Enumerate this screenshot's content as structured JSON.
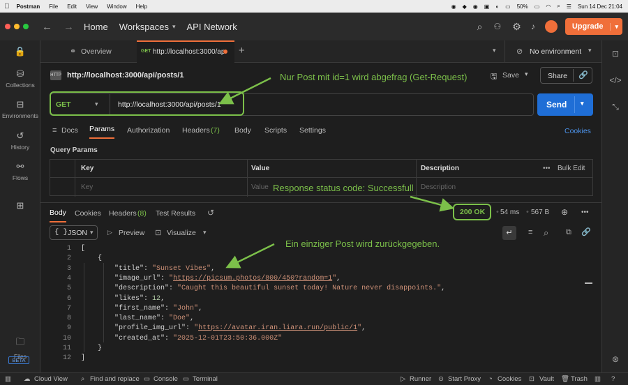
{
  "menubar": {
    "app": "Postman",
    "items": [
      "File",
      "Edit",
      "View",
      "Window",
      "Help"
    ],
    "battery": "50%",
    "datetime": "Sun 14 Dec 21:04"
  },
  "header": {
    "home": "Home",
    "workspaces": "Workspaces",
    "api_network": "API Network",
    "upgrade": "Upgrade"
  },
  "rail": {
    "items": [
      "Collections",
      "Environments",
      "History",
      "Flows"
    ],
    "files": "Files",
    "beta": "BETA"
  },
  "tabs": {
    "overview": "Overview",
    "active_method": "GET",
    "active_url": "http://localhost:3000/ap",
    "environment": "No environment"
  },
  "request": {
    "title": "http://localhost:3000/api/posts/1",
    "save": "Save",
    "share": "Share",
    "method": "GET",
    "url": "http://localhost:3000/api/posts/1",
    "send": "Send"
  },
  "req_tabs": {
    "docs": "Docs",
    "params": "Params",
    "authorization": "Authorization",
    "headers": "Headers",
    "headers_count": "(7)",
    "body": "Body",
    "scripts": "Scripts",
    "settings": "Settings",
    "cookies": "Cookies"
  },
  "query_params": {
    "title": "Query Params",
    "col_key": "Key",
    "col_value": "Value",
    "col_description": "Description",
    "bulk_edit": "Bulk Edit",
    "ph_key": "Key",
    "ph_value": "Value",
    "ph_description": "Description"
  },
  "response": {
    "tab_body": "Body",
    "tab_cookies": "Cookies",
    "tab_headers": "Headers",
    "headers_count": "(8)",
    "tab_tests": "Test Results",
    "status": "200 OK",
    "time": "54 ms",
    "size": "567 B",
    "format": "JSON",
    "preview": "Preview",
    "visualize": "Visualize"
  },
  "code_lines": [
    {
      "n": "1",
      "text": "["
    },
    {
      "n": "2",
      "text": "    {"
    },
    {
      "n": "3",
      "key": "\"title\"",
      "val": "\"Sunset Vibes\"",
      "type": "s"
    },
    {
      "n": "4",
      "key": "\"image_url\"",
      "val": "\"https://picsum.photos/800/450?random=1\"",
      "type": "u"
    },
    {
      "n": "5",
      "key": "\"description\"",
      "val": "\"Caught this beautiful sunset today! Nature never disappoints.\"",
      "type": "s"
    },
    {
      "n": "6",
      "key": "\"likes\"",
      "val": "12",
      "type": "n"
    },
    {
      "n": "7",
      "key": "\"first_name\"",
      "val": "\"John\"",
      "type": "s"
    },
    {
      "n": "8",
      "key": "\"last_name\"",
      "val": "\"Doe\"",
      "type": "s"
    },
    {
      "n": "9",
      "key": "\"profile_img_url\"",
      "val": "\"https://avatar.iran.liara.run/public/1\"",
      "type": "u"
    },
    {
      "n": "10",
      "key": "\"created_at\"",
      "val": "\"2025-12-01T23:50:36.000Z\"",
      "type": "s",
      "last": true
    },
    {
      "n": "11",
      "text": "    }"
    },
    {
      "n": "12",
      "text": "]"
    }
  ],
  "annotations": {
    "a1": "Nur Post mit id=1 wird abgefrag (Get-Request)",
    "a2": "Response status code: Successfull",
    "a3": "Ein einziger Post wird zurückgegeben."
  },
  "statusbar": {
    "cloud": "Cloud View",
    "find": "Find and replace",
    "console": "Console",
    "terminal": "Terminal",
    "runner": "Runner",
    "proxy": "Start Proxy",
    "cookies": "Cookies",
    "vault": "Vault",
    "trash": "Trash"
  },
  "colors": {
    "accent_orange": "#f06f3a",
    "send_blue": "#1f6ed6",
    "annotation_green": "#7cc04a"
  }
}
